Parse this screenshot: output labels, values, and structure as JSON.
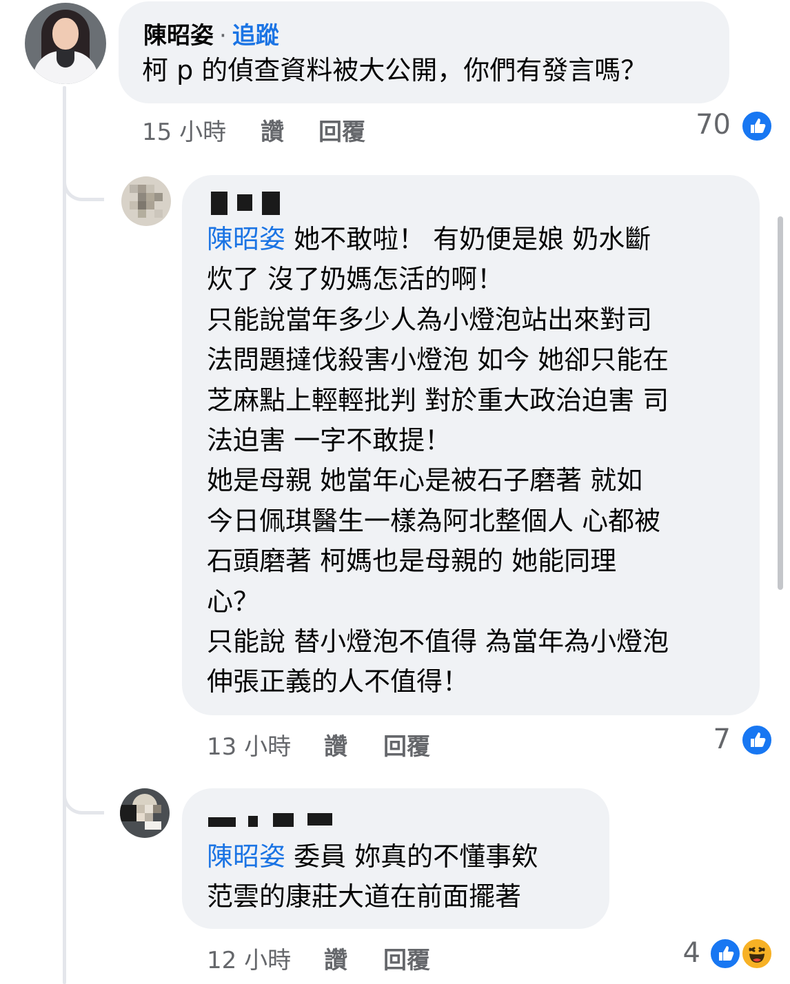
{
  "comments": [
    {
      "author": "陳昭姿",
      "separator": "·",
      "follow_label": "追蹤",
      "text_lines": [
        "柯 p 的偵查資料被大公開，你們有發言嗎？"
      ],
      "time": "15 小時",
      "like_label": "讚",
      "reply_label": "回覆",
      "reaction_count": "70",
      "reactions": [
        "like-icon"
      ]
    },
    {
      "mention": "陳昭姿",
      "text_lines": [
        " 她不敢啦！  有奶便是娘 奶水斷",
        "炊了 沒了奶媽怎活的啊！",
        "只能說當年多少人為小燈泡站出來對司",
        "法問題撻伐殺害小燈泡 如今 她卻只能在",
        "芝麻點上輕輕批判 對於重大政治迫害 司",
        "法迫害 一字不敢提！",
        "她是母親 她當年心是被石子磨著  就如",
        "今日佩琪醫生一樣為阿北整個人 心都被",
        "石頭磨著 柯媽也是母親的 她能同理",
        "心？",
        "只能說 替小燈泡不值得 為當年為小燈泡",
        "伸張正義的人不值得！"
      ],
      "time": "13 小時",
      "like_label": "讚",
      "reply_label": "回覆",
      "reaction_count": "7",
      "reactions": [
        "like-icon"
      ]
    },
    {
      "mention": "陳昭姿",
      "text_lines": [
        " 委員 妳真的不懂事欸",
        "范雲的康莊大道在前面擺著"
      ],
      "time": "12 小時",
      "like_label": "讚",
      "reply_label": "回覆",
      "reaction_count": "4",
      "reactions": [
        "like-icon",
        "haha-icon"
      ]
    }
  ],
  "colors": {
    "bubble_bg": "#f0f2f5",
    "link_blue": "#1b74e4",
    "meta_gray": "#65676b",
    "like_blue": "#1877f2",
    "haha_yellow": "#f7b125"
  }
}
